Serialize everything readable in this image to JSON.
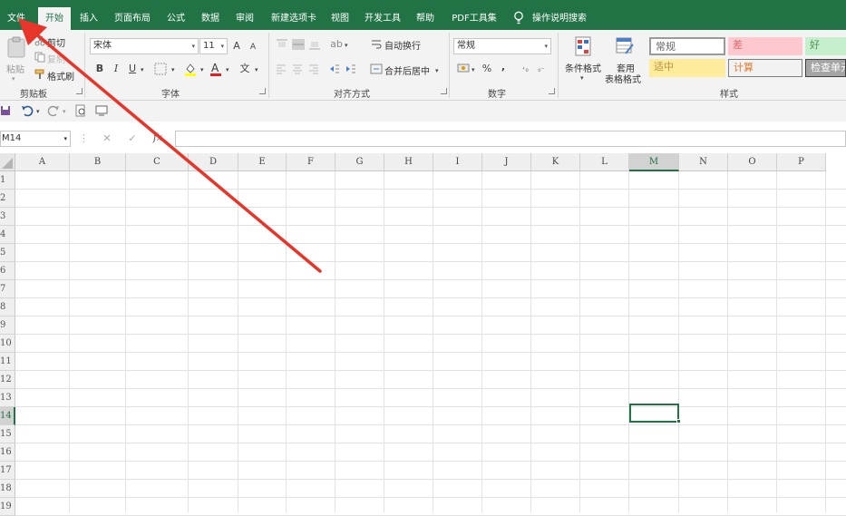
{
  "tabs": [
    {
      "label": "文件",
      "active": false
    },
    {
      "label": "开始",
      "active": true
    },
    {
      "label": "插入",
      "active": false
    },
    {
      "label": "页面布局",
      "active": false
    },
    {
      "label": "公式",
      "active": false
    },
    {
      "label": "数据",
      "active": false
    },
    {
      "label": "审阅",
      "active": false
    },
    {
      "label": "新建选项卡",
      "active": false
    },
    {
      "label": "视图",
      "active": false
    },
    {
      "label": "开发工具",
      "active": false
    },
    {
      "label": "帮助",
      "active": false
    },
    {
      "label": "PDF工具集",
      "active": false
    },
    {
      "label": "操作说明搜索",
      "active": false
    }
  ],
  "ribbon": {
    "clipboard": {
      "paste": "粘贴",
      "cut": "剪切",
      "copy": "复制",
      "format_painter": "格式刷",
      "group": "剪贴板"
    },
    "font": {
      "name": "宋体",
      "size": "11",
      "bold": "B",
      "italic": "I",
      "underline": "U",
      "grow": "A",
      "shrink": "A",
      "group": "字体"
    },
    "alignment": {
      "wrap": "自动换行",
      "merge": "合并后居中",
      "group": "对齐方式"
    },
    "number": {
      "format": "常规",
      "percent": "%",
      "comma": ",",
      "group": "数字"
    },
    "styles": {
      "conditional": "条件格式",
      "table_format_1": "套用",
      "table_format_2": "表格格式",
      "group": "样式",
      "cells": [
        {
          "label": "常规",
          "bg": "#ffffff",
          "color": "#666666",
          "border": "#9a9a9a"
        },
        {
          "label": "差",
          "bg": "#ffc7ce",
          "color": "#d86c6c",
          "border": "#ffc7ce"
        },
        {
          "label": "好",
          "bg": "#c6efce",
          "color": "#4f8f4f",
          "border": "#c6efce"
        },
        {
          "label": "适中",
          "bg": "#ffeb9c",
          "color": "#b8923c",
          "border": "#ffeb9c"
        },
        {
          "label": "计算",
          "bg": "#f2f2f2",
          "color": "#e07a2e",
          "border": "#7f7f7f"
        },
        {
          "label": "检查单元",
          "bg": "#a5a5a5",
          "color": "#ffffff",
          "border": "#3f3f3f"
        }
      ]
    }
  },
  "formula_bar": {
    "name_box": "M14",
    "cancel": "✕",
    "enter": "✓",
    "fx": "fx",
    "value": ""
  },
  "grid": {
    "columns": [
      "A",
      "B",
      "C",
      "D",
      "E",
      "F",
      "G",
      "H",
      "I",
      "J",
      "K",
      "L",
      "M",
      "N",
      "O",
      "P"
    ],
    "rows": [
      "1",
      "2",
      "3",
      "4",
      "5",
      "6",
      "7",
      "8",
      "9",
      "10",
      "11",
      "12",
      "13",
      "14",
      "15",
      "16",
      "17",
      "18",
      "19"
    ],
    "selected_column": "M",
    "selected_row": "14"
  },
  "colors": {
    "accent": "#217346",
    "arrow": "#e8352a"
  }
}
